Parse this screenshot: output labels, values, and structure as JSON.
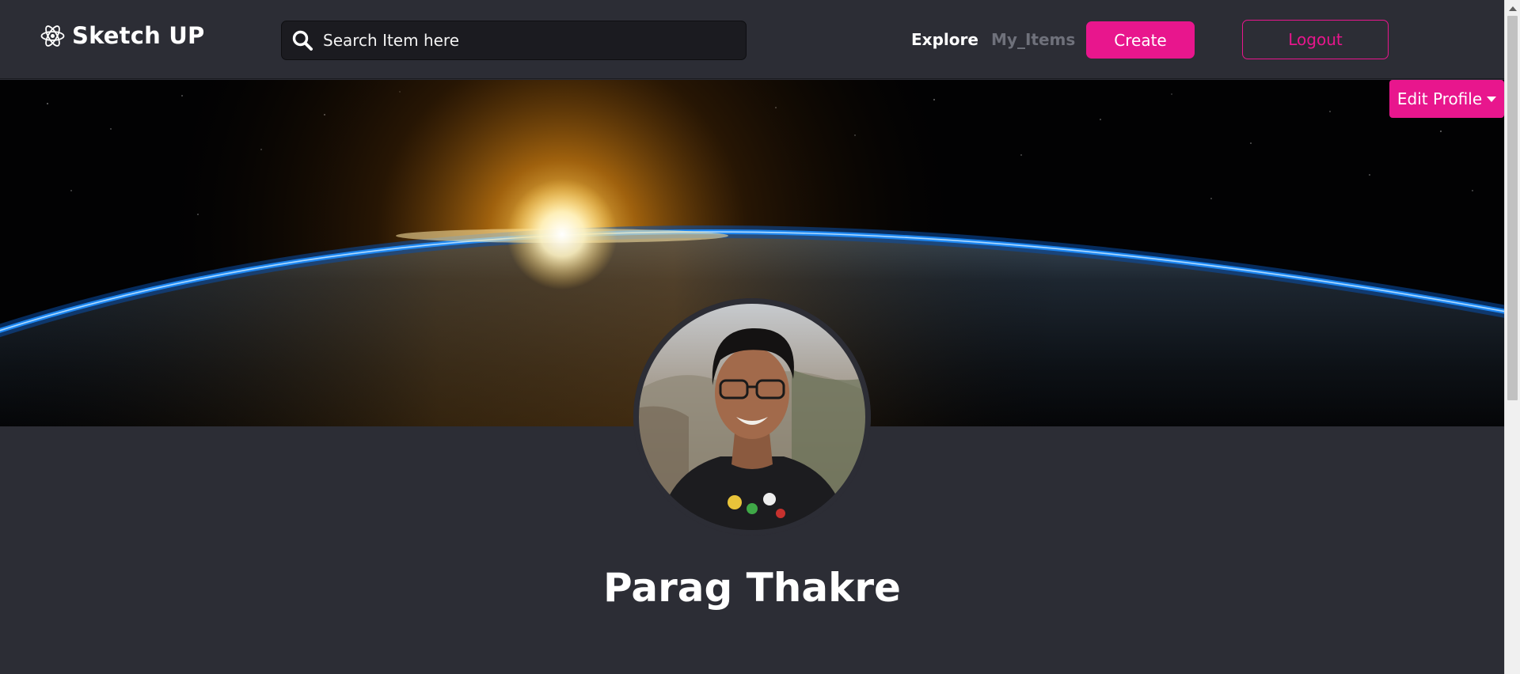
{
  "brand": {
    "name": "Sketch UP",
    "icon": "atom-icon"
  },
  "search": {
    "placeholder": "Search Item here",
    "value": "",
    "icon": "search-icon"
  },
  "nav": {
    "explore_label": "Explore",
    "my_items_label": "My_Items",
    "create_label": "Create",
    "logout_label": "Logout"
  },
  "profile": {
    "edit_label": "Edit Profile",
    "name": "Parag Thakre"
  },
  "colors": {
    "accent": "#e8168d",
    "background": "#2c2d35",
    "search_bg": "#1b1b20",
    "muted_link": "#6f717b"
  }
}
